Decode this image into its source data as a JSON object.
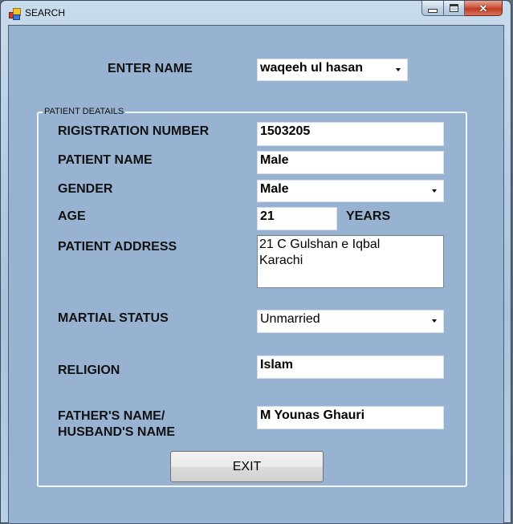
{
  "window": {
    "title": "SEARCH",
    "app_icon": "form-icon",
    "controls": {
      "minimize": "minimize-icon",
      "maximize": "maximize-icon",
      "close": "close-icon",
      "close_glyph": "✕"
    }
  },
  "search": {
    "label": "ENTER NAME",
    "selected_value": "waqeeh ul hasan"
  },
  "details": {
    "group_title": "PATIENT DEATAILS",
    "registration": {
      "label": "RIGISTRATION NUMBER",
      "value": "1503205"
    },
    "patient_name": {
      "label": "PATIENT NAME",
      "value": "Male"
    },
    "gender": {
      "label": "GENDER",
      "value": "Male"
    },
    "age": {
      "label": "AGE",
      "value": "21",
      "unit": "YEARS"
    },
    "address": {
      "label": "PATIENT ADDRESS",
      "line1": "21 C Gulshan e Iqbal",
      "line2": "Karachi"
    },
    "marital_status": {
      "label": "MARTIAL STATUS",
      "value": "Unmarried"
    },
    "religion": {
      "label": "RELIGION",
      "value": "Islam"
    },
    "guardian": {
      "label_line1": "FATHER'S NAME/",
      "label_line2": "HUSBAND'S NAME",
      "value": "M Younas Ghauri"
    }
  },
  "actions": {
    "exit_label": "EXIT"
  }
}
